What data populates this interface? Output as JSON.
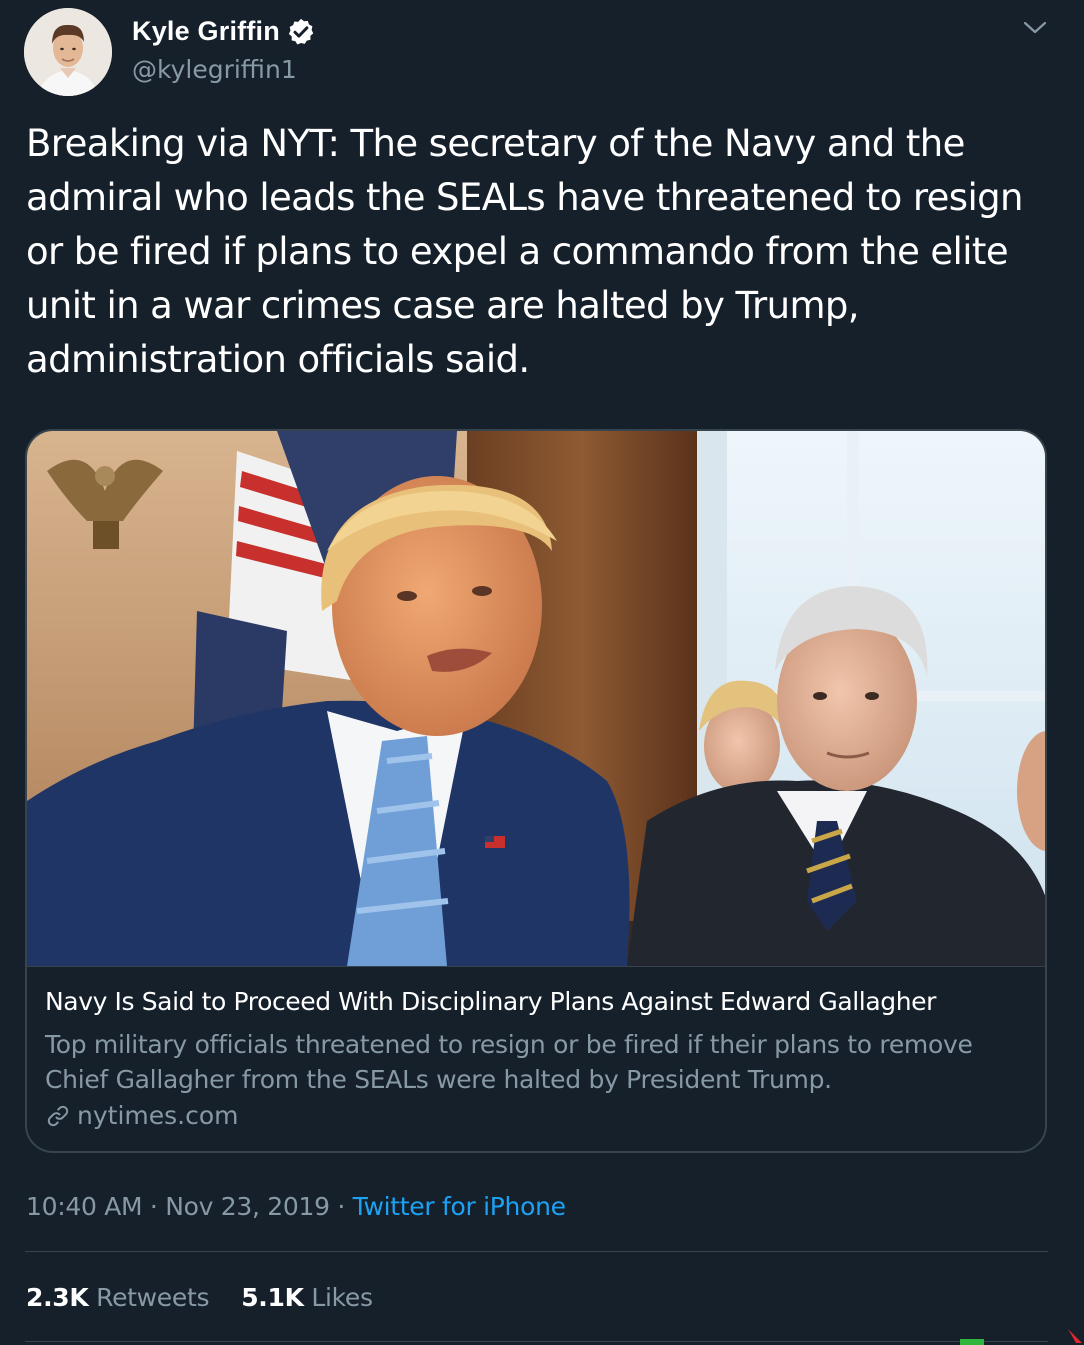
{
  "author": {
    "display_name": "Kyle Griffin",
    "handle": "@kylegriffin1",
    "verified": true,
    "avatar_icon": "avatar-photo"
  },
  "tweet": {
    "text": "Breaking via NYT: The secretary of the Navy and the admiral who leads the SEALs have threatened to resign or be fired if plans to expel a commando from the elite unit in a war crimes case are halted by Trump, administration officials said."
  },
  "card": {
    "title": "Navy Is Said to Proceed With Disciplinary Plans Against Edward Gallagher",
    "description": "Top military officials threatened to resign or be fired if their plans to remove Chief Gallagher from the SEALs were halted by President Trump.",
    "domain": "nytimes.com",
    "link_icon": "link-icon"
  },
  "meta": {
    "time": "10:40 AM",
    "separator": "·",
    "date": "Nov 23, 2019",
    "source": "Twitter for iPhone"
  },
  "stats": {
    "retweets_count": "2.3K",
    "retweets_label": "Retweets",
    "likes_count": "5.1K",
    "likes_label": "Likes"
  },
  "colors": {
    "background": "#15202b",
    "border": "#38444d",
    "secondary_text": "#8899a6",
    "link": "#1da1f2",
    "verified_badge": "#ffffff"
  }
}
